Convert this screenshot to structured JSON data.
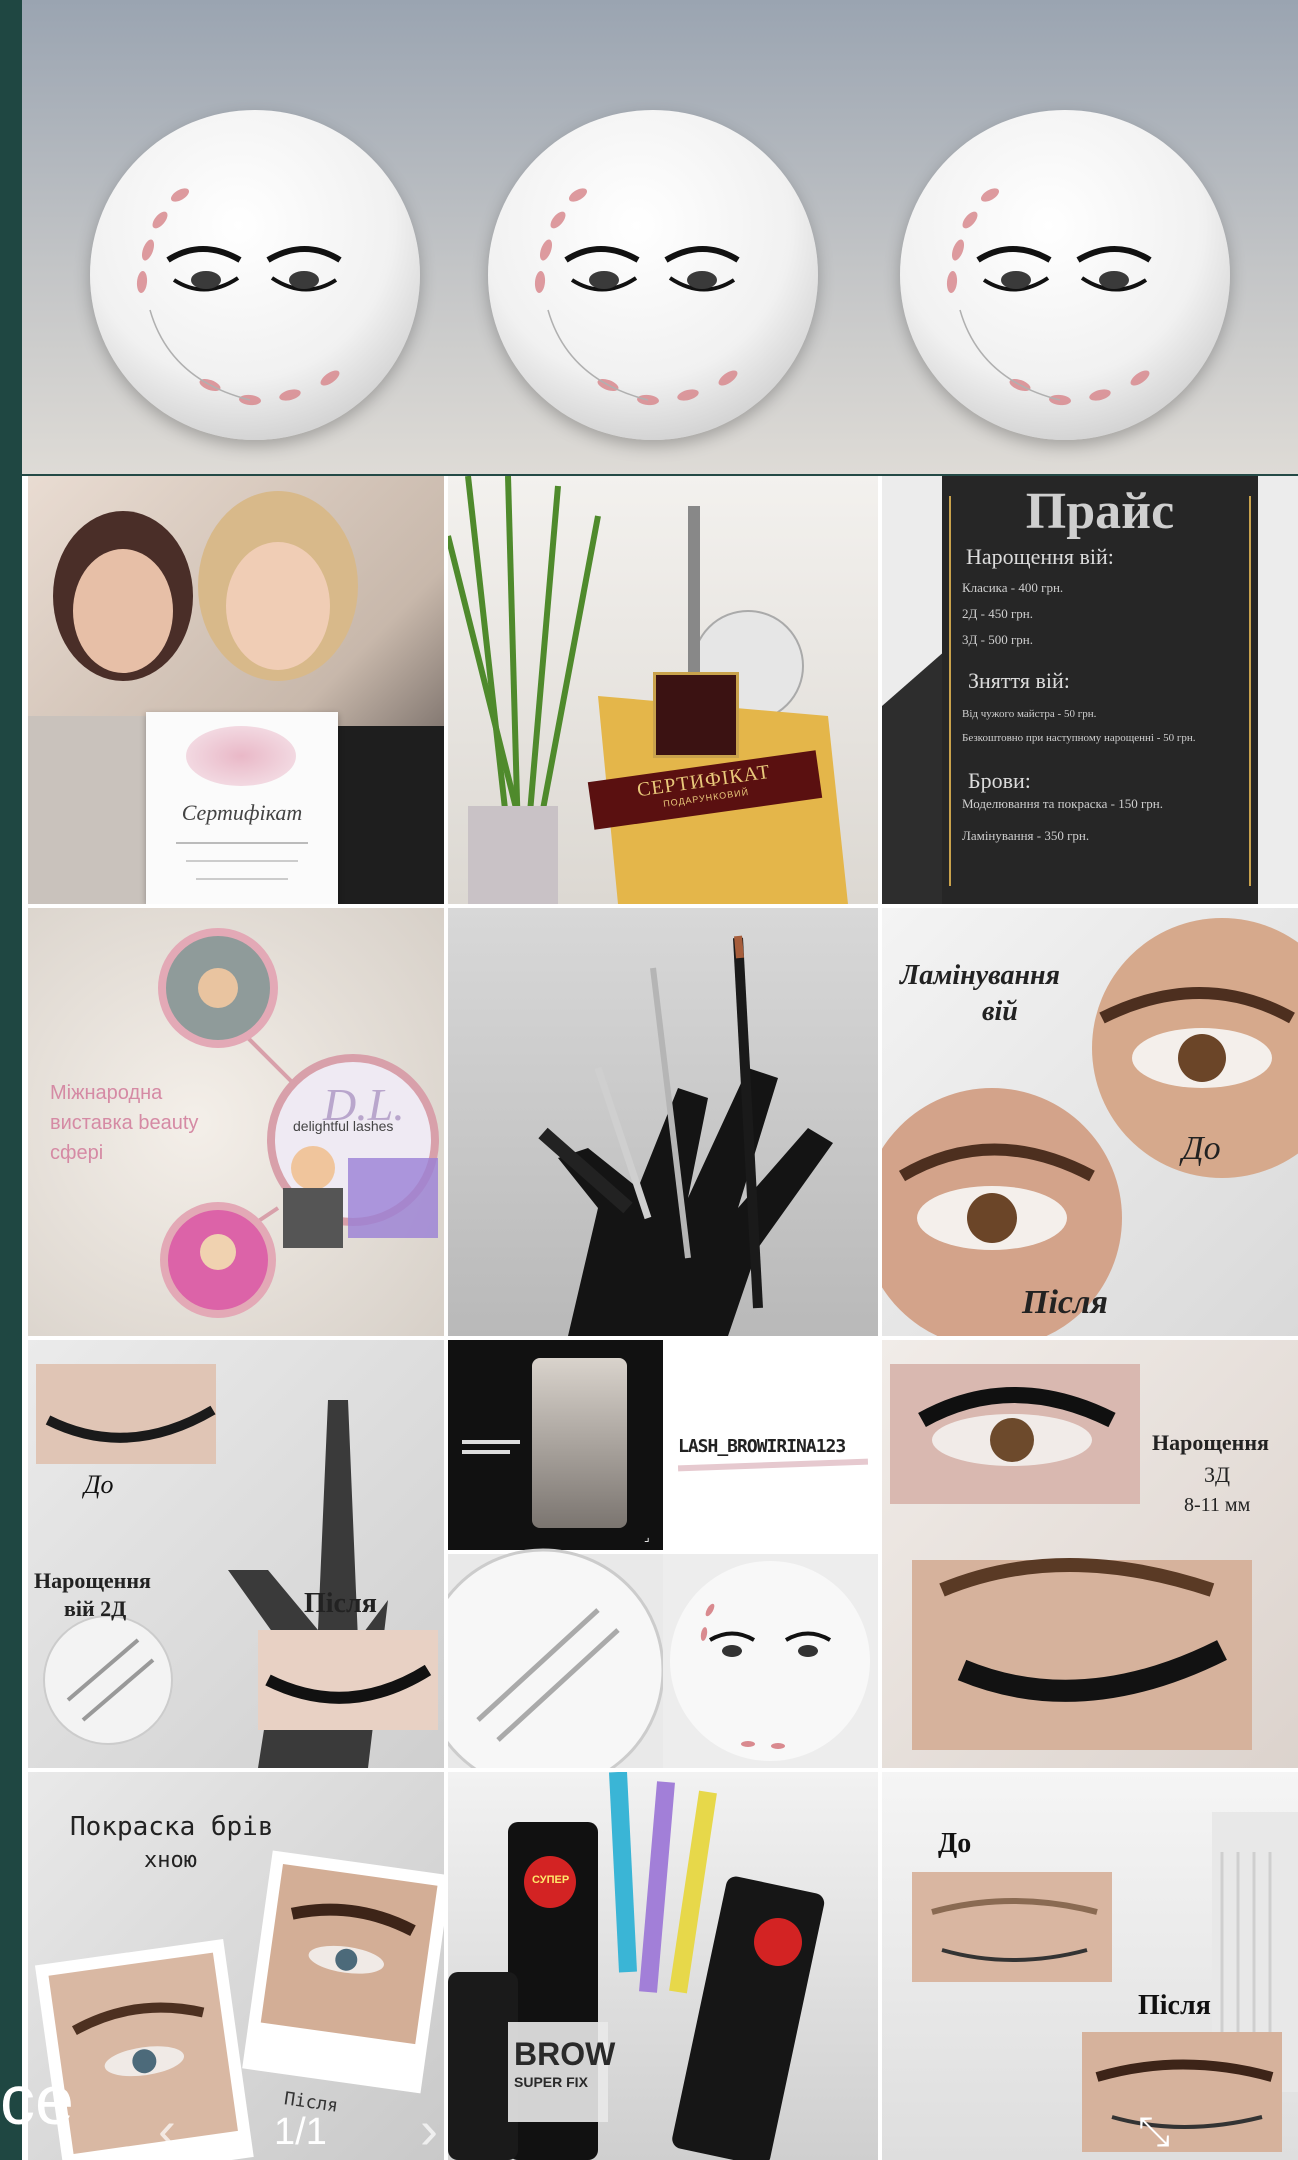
{
  "highlights": [
    {
      "name": "highlight-1"
    },
    {
      "name": "highlight-2"
    },
    {
      "name": "highlight-3"
    }
  ],
  "price_post": {
    "title": "Прайс",
    "section1": "Нарощення вій:",
    "line1": "Класика - 400 грн.",
    "line2": "2Д - 450 грн.",
    "line3": "3Д - 500 грн.",
    "section2": "Зняття вій:",
    "line4": "Від чужого майстра - 50 грн.",
    "line5": "Безкоштовно при наступному нарощенні - 50 грн.",
    "section3": "Брови:",
    "line6": "Моделювання та покраска - 150 грн.",
    "line7": "Ламінування - 350 грн."
  },
  "certificate_post": {
    "card_title": "Сертифікат",
    "award_label": "СЕРТИФІКАТ",
    "award_sub": "ПОДАРУНКОВИЙ"
  },
  "exhibition_post": {
    "line1": "Міжнародна",
    "line2": "виставка beauty",
    "line3": "сфері",
    "brand_letters": "D.L.",
    "brand_text": "delightful lashes"
  },
  "lamination_post": {
    "title_line1": "Ламінування",
    "title_line2": "вій",
    "before": "До",
    "after": "Після"
  },
  "extension2d_post": {
    "before": "До",
    "title_line1": "Нарощення",
    "title_line2": "вій 2Д",
    "after": "Після"
  },
  "profile_post": {
    "username": "LASH_BROWIRINA123"
  },
  "extension3d_post": {
    "line1": "Нарощення",
    "line2": "3Д",
    "line3": "8-11 мм"
  },
  "henna_post": {
    "title_line1": "Покраска брів",
    "title_line2": "хною",
    "after": "Після"
  },
  "products_post": {
    "brand": "BROW",
    "sub": "SUPER FIX",
    "badge": "СУПЕР"
  },
  "beforeafter_post": {
    "before": "До",
    "after": "Після"
  },
  "viewer": {
    "partial_text": "ce",
    "counter": "1/1"
  },
  "colors": {
    "strip": "#1f4742",
    "price_bg": "#262626",
    "gold": "#c9a24c",
    "pink": "#d8a0aa"
  }
}
